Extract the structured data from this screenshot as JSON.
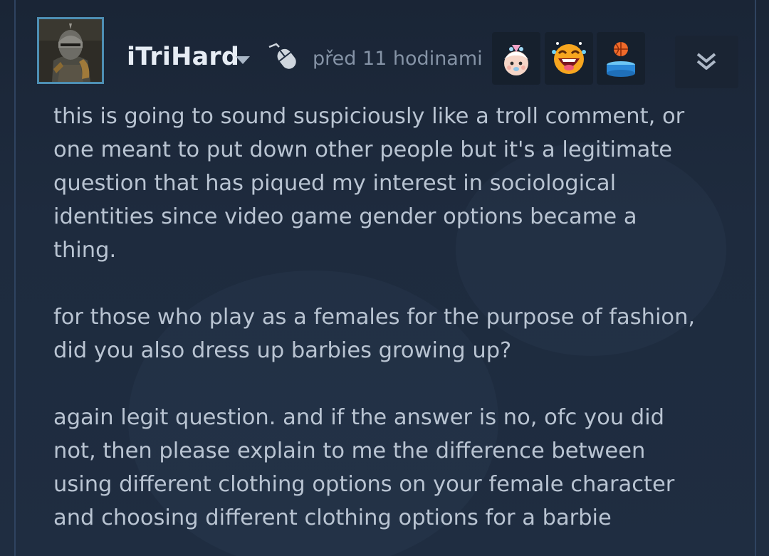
{
  "comment": {
    "author": "iTriHard",
    "timestamp": "před 11 hodinami",
    "paragraphs": [
      [
        "this is going to sound suspiciously like a troll comment, or",
        "one meant to put down other people but it's a legitimate",
        "question that has piqued my interest in sociological",
        "identities since video game gender options became a",
        "thing."
      ],
      [
        "for those who play as a females for the purpose of fashion,",
        "did you also dress up barbies growing up?"
      ],
      [
        "again legit question. and if the answer is no, ofc you did",
        "not, then please explain to me the difference between",
        "using different clothing options on your female character",
        "and choosing different clothing options for a barbie"
      ]
    ]
  },
  "icons": {
    "author_menu": "chevron-down-icon",
    "device": "mouse-icon",
    "reactions": [
      "baby-face-icon",
      "laughing-face-icon",
      "basketball-hoop-icon"
    ],
    "expand": "double-chevron-down-icon"
  },
  "colors": {
    "background": "#1f2c40",
    "author_name": "#e6ecf4",
    "timestamp": "#8593a6",
    "body_text": "#b9c4d2",
    "avatar_border": "#4e8fb4",
    "reaction_bg": "#16202d"
  }
}
